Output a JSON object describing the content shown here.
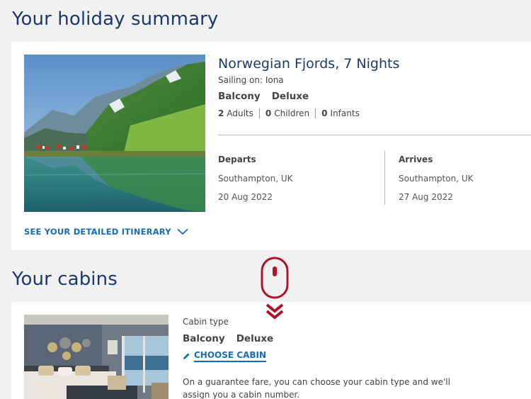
{
  "summary": {
    "heading": "Your holiday summary",
    "cruise_title": "Norwegian Fjords, 7 Nights",
    "sailing_on": "Sailing on: Iona",
    "cabin_grade": "Balcony",
    "cabin_level": "Deluxe",
    "adults_count": "2",
    "adults_label": "Adults",
    "children_count": "0",
    "children_label": "Children",
    "infants_count": "0",
    "infants_label": "Infants",
    "departs_label": "Departs",
    "departs_port": "Southampton, UK",
    "departs_date": "20 Aug 2022",
    "arrives_label": "Arrives",
    "arrives_port": "Southampton, UK",
    "arrives_date": "27 Aug 2022",
    "itinerary_link": "SEE YOUR DETAILED ITINERARY"
  },
  "cabins": {
    "heading": "Your cabins",
    "cabin_type_label": "Cabin type",
    "cabin_grade": "Balcony",
    "cabin_level": "Deluxe",
    "choose_cabin": "CHOOSE CABIN",
    "guarantee_text": "On a guarantee fare, you can choose your cabin type and we'll assign you a cabin number."
  },
  "icons": {
    "chevron": "chevron-down-icon",
    "pencil": "pencil-icon",
    "scroll": "mouse-scroll-icon"
  },
  "colors": {
    "page_bg": "#f2f1f2",
    "heading": "#1b3a6b",
    "link": "#1a6bb5",
    "scroll_hint": "#b0132b"
  }
}
